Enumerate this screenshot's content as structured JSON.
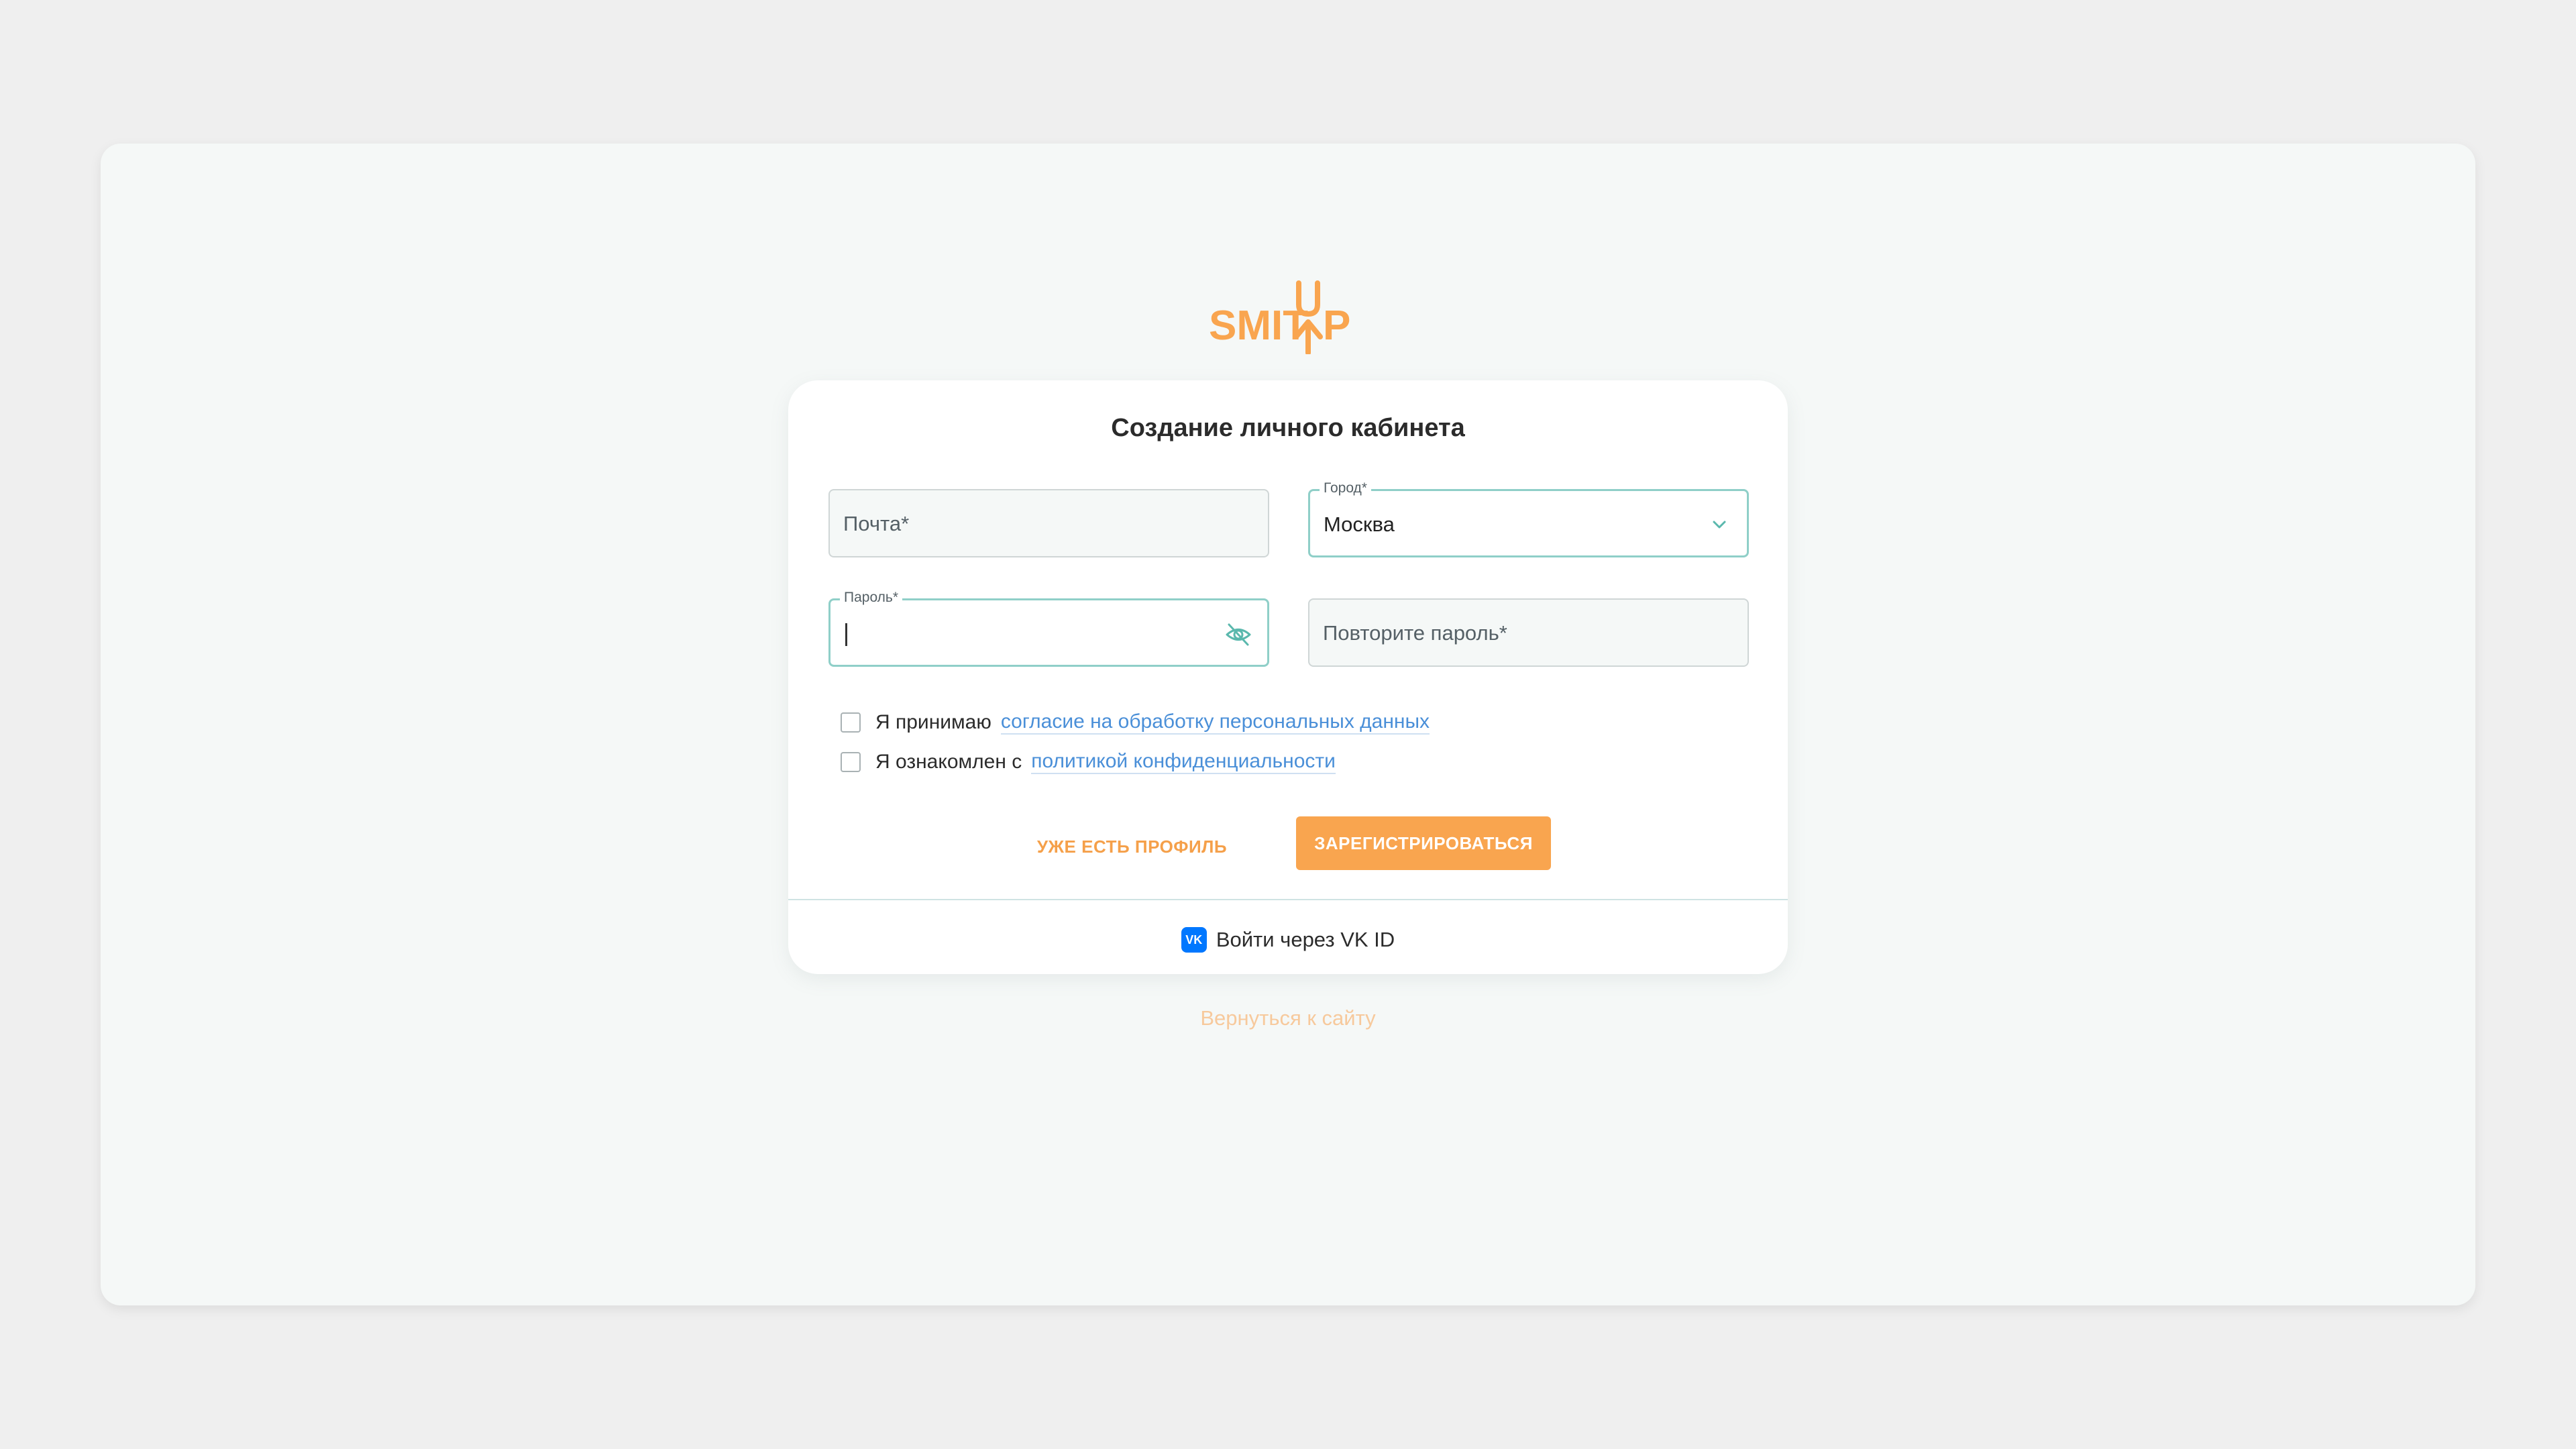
{
  "brand": {
    "logo_text": "SMITUP",
    "color": "#f9a54f"
  },
  "form": {
    "title": "Создание личного кабинета",
    "email": {
      "placeholder": "Почта*"
    },
    "city": {
      "label": "Город*",
      "value": "Москва",
      "icon": "chevron-down-icon"
    },
    "password": {
      "label": "Пароль*",
      "value": "",
      "icon": "eye-off-icon"
    },
    "repeat_password": {
      "placeholder": "Повторите пароль*"
    },
    "consent": {
      "prefix": "Я принимаю",
      "link": "согласие на обработку персональных данных",
      "checked": false
    },
    "privacy": {
      "prefix": "Я ознакомлен с",
      "link": "политикой конфиденциальности",
      "checked": false
    },
    "have_profile_label": "УЖЕ ЕСТЬ ПРОФИЛЬ",
    "register_label": "ЗАРЕГИСТРИРОВАТЬСЯ",
    "vk_label": "Войти через VK ID",
    "vk_icon_text": "VK"
  },
  "back_link": "Вернуться к сайту",
  "colors": {
    "accent": "#f9a54f",
    "link": "#4a8fd8",
    "focus_border": "#8fcfc8",
    "vk": "#0077ff"
  }
}
